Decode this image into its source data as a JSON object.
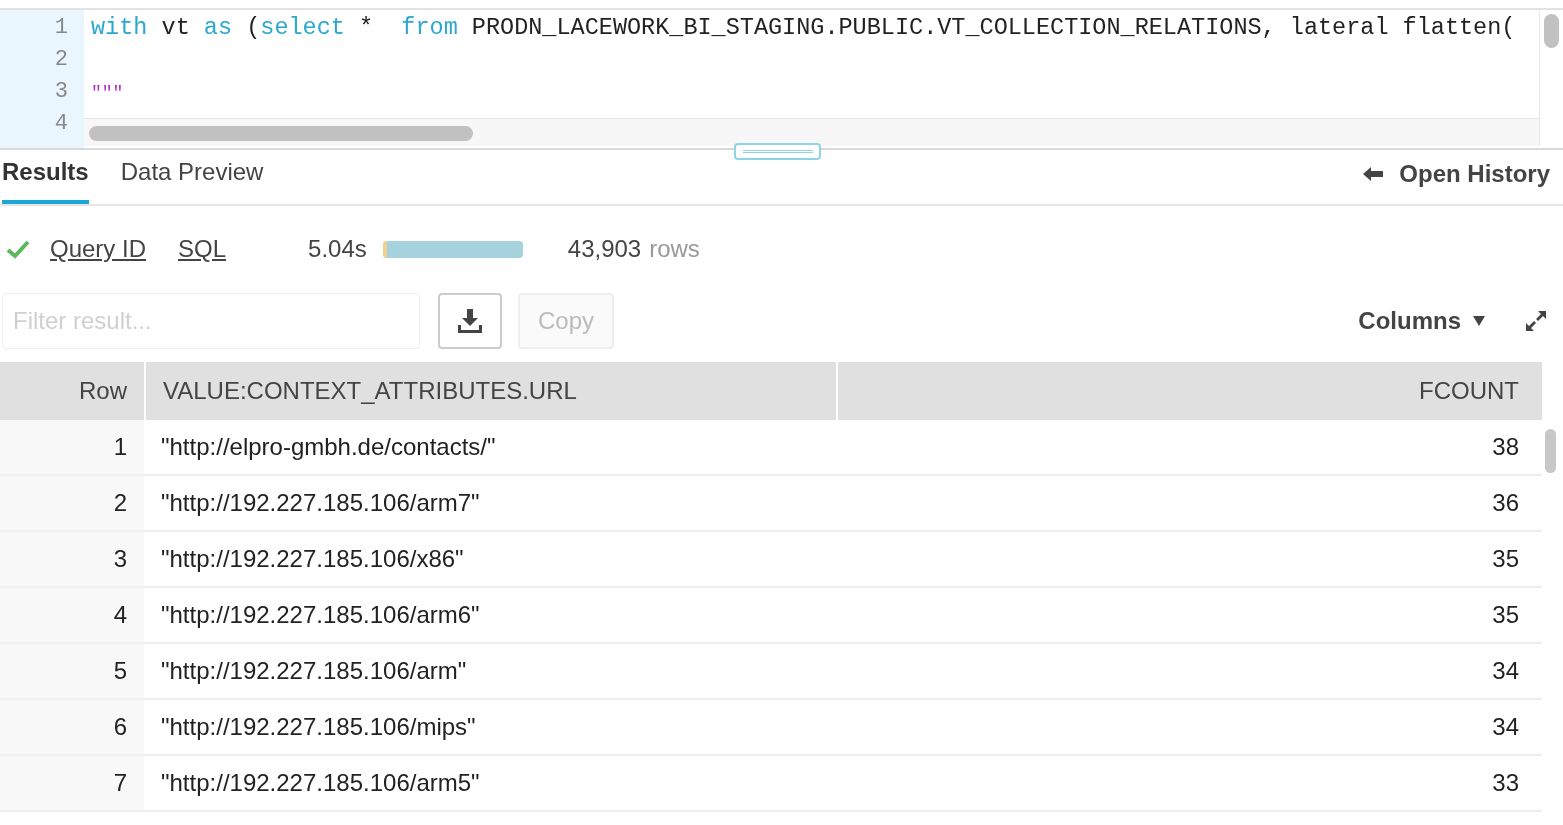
{
  "editor": {
    "lines": [
      {
        "number": "1",
        "tokens": [
          {
            "kind": "keyword",
            "text": "with"
          },
          {
            "kind": "plain",
            "text": " vt "
          },
          {
            "kind": "keyword",
            "text": "as"
          },
          {
            "kind": "plain",
            "text": " ("
          },
          {
            "kind": "keyword",
            "text": "select"
          },
          {
            "kind": "plain",
            "text": " *  "
          },
          {
            "kind": "keyword",
            "text": "from"
          },
          {
            "kind": "plain",
            "text": " PRODN_LACEWORK_BI_STAGING.PUBLIC.VT_COLLECTION_RELATIONS, lateral flatten("
          }
        ]
      },
      {
        "number": "2"
      },
      {
        "number": "3",
        "tokens": [
          {
            "kind": "string",
            "text": "\"\"\""
          }
        ]
      },
      {
        "number": "4"
      }
    ]
  },
  "tabs": [
    {
      "label": "Results",
      "selected": true
    },
    {
      "label": "Data Preview",
      "selected": false
    }
  ],
  "open_history": "Open History",
  "status": {
    "success": true,
    "query_id": "Query ID",
    "sql": "SQL",
    "duration": "5.04s",
    "timing_bar": {
      "level": 0.03
    },
    "row_count": "43,903",
    "row_unit": "rows"
  },
  "toolbar": {
    "filter": {
      "placeholder": "Filter result..."
    },
    "copy": {
      "label": "Copy",
      "disabled": true
    },
    "columns": "Columns"
  },
  "table": {
    "columns": [
      "Row",
      "VALUE:CONTEXT_ATTRIBUTES.URL",
      "FCOUNT"
    ],
    "rows": [
      [
        "1",
        "\"http://elpro-gmbh.de/contacts/\"",
        "38"
      ],
      [
        "2",
        "\"http://192.227.185.106/arm7\"",
        "36"
      ],
      [
        "3",
        "\"http://192.227.185.106/x86\"",
        "35"
      ],
      [
        "4",
        "\"http://192.227.185.106/arm6\"",
        "35"
      ],
      [
        "5",
        "\"http://192.227.185.106/arm\"",
        "34"
      ],
      [
        "6",
        "\"http://192.227.185.106/mips\"",
        "34"
      ],
      [
        "7",
        "\"http://192.227.185.106/arm5\"",
        "33"
      ]
    ]
  }
}
